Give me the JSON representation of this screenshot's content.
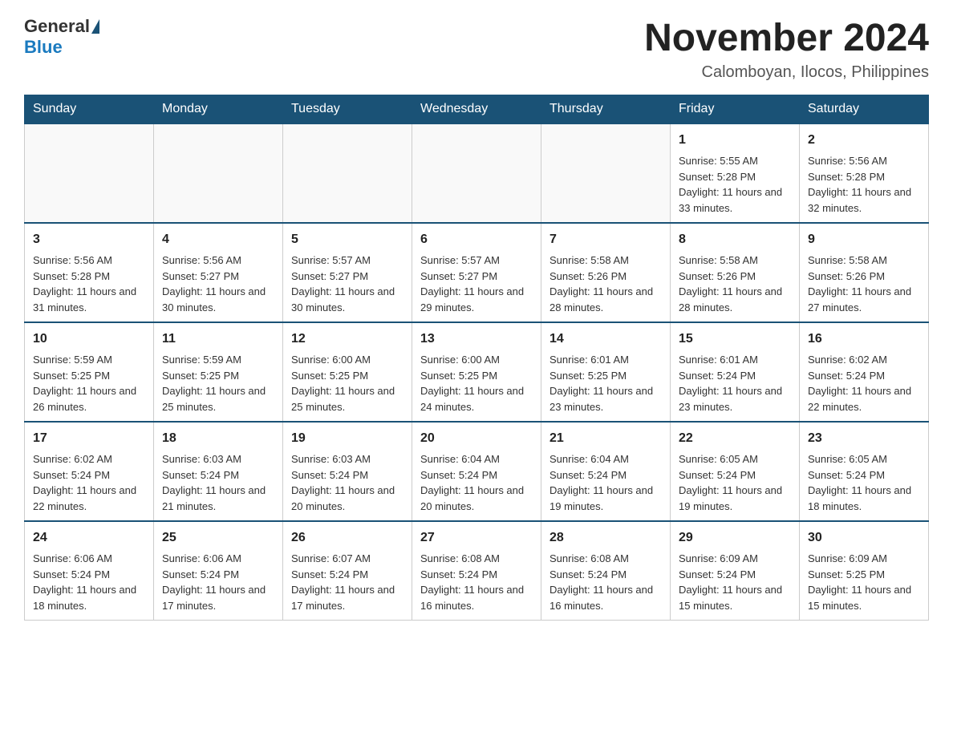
{
  "header": {
    "logo_general": "General",
    "logo_blue": "Blue",
    "month_title": "November 2024",
    "location": "Calomboyan, Ilocos, Philippines"
  },
  "days_of_week": [
    "Sunday",
    "Monday",
    "Tuesday",
    "Wednesday",
    "Thursday",
    "Friday",
    "Saturday"
  ],
  "weeks": [
    [
      {
        "day": "",
        "info": ""
      },
      {
        "day": "",
        "info": ""
      },
      {
        "day": "",
        "info": ""
      },
      {
        "day": "",
        "info": ""
      },
      {
        "day": "",
        "info": ""
      },
      {
        "day": "1",
        "info": "Sunrise: 5:55 AM\nSunset: 5:28 PM\nDaylight: 11 hours and 33 minutes."
      },
      {
        "day": "2",
        "info": "Sunrise: 5:56 AM\nSunset: 5:28 PM\nDaylight: 11 hours and 32 minutes."
      }
    ],
    [
      {
        "day": "3",
        "info": "Sunrise: 5:56 AM\nSunset: 5:28 PM\nDaylight: 11 hours and 31 minutes."
      },
      {
        "day": "4",
        "info": "Sunrise: 5:56 AM\nSunset: 5:27 PM\nDaylight: 11 hours and 30 minutes."
      },
      {
        "day": "5",
        "info": "Sunrise: 5:57 AM\nSunset: 5:27 PM\nDaylight: 11 hours and 30 minutes."
      },
      {
        "day": "6",
        "info": "Sunrise: 5:57 AM\nSunset: 5:27 PM\nDaylight: 11 hours and 29 minutes."
      },
      {
        "day": "7",
        "info": "Sunrise: 5:58 AM\nSunset: 5:26 PM\nDaylight: 11 hours and 28 minutes."
      },
      {
        "day": "8",
        "info": "Sunrise: 5:58 AM\nSunset: 5:26 PM\nDaylight: 11 hours and 28 minutes."
      },
      {
        "day": "9",
        "info": "Sunrise: 5:58 AM\nSunset: 5:26 PM\nDaylight: 11 hours and 27 minutes."
      }
    ],
    [
      {
        "day": "10",
        "info": "Sunrise: 5:59 AM\nSunset: 5:25 PM\nDaylight: 11 hours and 26 minutes."
      },
      {
        "day": "11",
        "info": "Sunrise: 5:59 AM\nSunset: 5:25 PM\nDaylight: 11 hours and 25 minutes."
      },
      {
        "day": "12",
        "info": "Sunrise: 6:00 AM\nSunset: 5:25 PM\nDaylight: 11 hours and 25 minutes."
      },
      {
        "day": "13",
        "info": "Sunrise: 6:00 AM\nSunset: 5:25 PM\nDaylight: 11 hours and 24 minutes."
      },
      {
        "day": "14",
        "info": "Sunrise: 6:01 AM\nSunset: 5:25 PM\nDaylight: 11 hours and 23 minutes."
      },
      {
        "day": "15",
        "info": "Sunrise: 6:01 AM\nSunset: 5:24 PM\nDaylight: 11 hours and 23 minutes."
      },
      {
        "day": "16",
        "info": "Sunrise: 6:02 AM\nSunset: 5:24 PM\nDaylight: 11 hours and 22 minutes."
      }
    ],
    [
      {
        "day": "17",
        "info": "Sunrise: 6:02 AM\nSunset: 5:24 PM\nDaylight: 11 hours and 22 minutes."
      },
      {
        "day": "18",
        "info": "Sunrise: 6:03 AM\nSunset: 5:24 PM\nDaylight: 11 hours and 21 minutes."
      },
      {
        "day": "19",
        "info": "Sunrise: 6:03 AM\nSunset: 5:24 PM\nDaylight: 11 hours and 20 minutes."
      },
      {
        "day": "20",
        "info": "Sunrise: 6:04 AM\nSunset: 5:24 PM\nDaylight: 11 hours and 20 minutes."
      },
      {
        "day": "21",
        "info": "Sunrise: 6:04 AM\nSunset: 5:24 PM\nDaylight: 11 hours and 19 minutes."
      },
      {
        "day": "22",
        "info": "Sunrise: 6:05 AM\nSunset: 5:24 PM\nDaylight: 11 hours and 19 minutes."
      },
      {
        "day": "23",
        "info": "Sunrise: 6:05 AM\nSunset: 5:24 PM\nDaylight: 11 hours and 18 minutes."
      }
    ],
    [
      {
        "day": "24",
        "info": "Sunrise: 6:06 AM\nSunset: 5:24 PM\nDaylight: 11 hours and 18 minutes."
      },
      {
        "day": "25",
        "info": "Sunrise: 6:06 AM\nSunset: 5:24 PM\nDaylight: 11 hours and 17 minutes."
      },
      {
        "day": "26",
        "info": "Sunrise: 6:07 AM\nSunset: 5:24 PM\nDaylight: 11 hours and 17 minutes."
      },
      {
        "day": "27",
        "info": "Sunrise: 6:08 AM\nSunset: 5:24 PM\nDaylight: 11 hours and 16 minutes."
      },
      {
        "day": "28",
        "info": "Sunrise: 6:08 AM\nSunset: 5:24 PM\nDaylight: 11 hours and 16 minutes."
      },
      {
        "day": "29",
        "info": "Sunrise: 6:09 AM\nSunset: 5:24 PM\nDaylight: 11 hours and 15 minutes."
      },
      {
        "day": "30",
        "info": "Sunrise: 6:09 AM\nSunset: 5:25 PM\nDaylight: 11 hours and 15 minutes."
      }
    ]
  ]
}
